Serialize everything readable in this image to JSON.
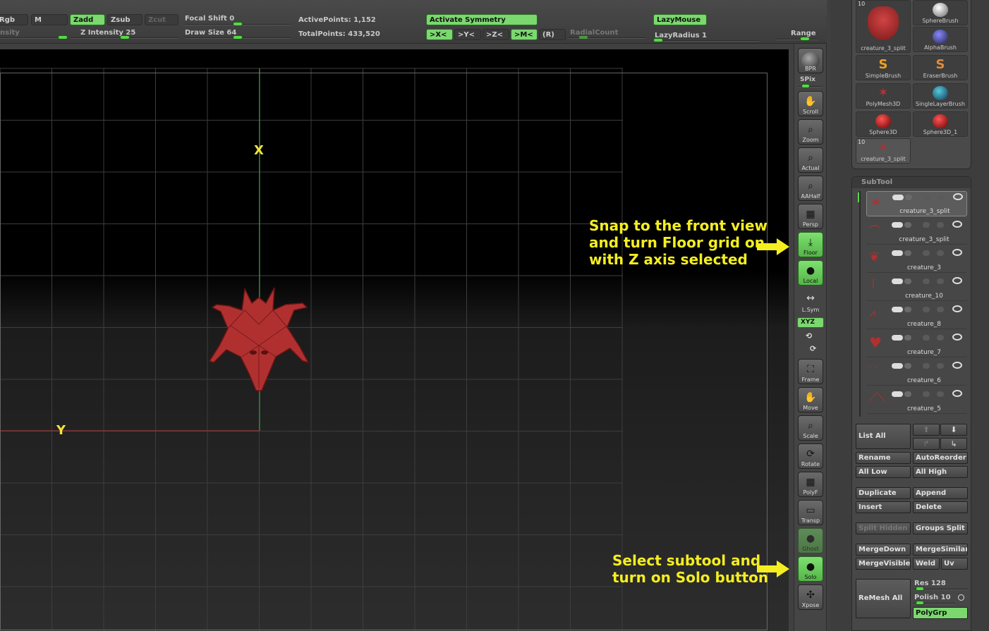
{
  "topbar": {
    "rgb": "Rgb",
    "m": "M",
    "zadd": "Zadd",
    "zsub": "Zsub",
    "zcut": "Zcut",
    "intensity_label": "nsity",
    "z_intensity": "Z Intensity 25",
    "focal_shift": "Focal Shift 0",
    "draw_size": "Draw Size 64",
    "active_points": "ActivePoints: 1,152",
    "total_points": "TotalPoints: 433,520",
    "activate_symmetry": "Activate Symmetry",
    "sym_x": ">X<",
    "sym_y": ">Y<",
    "sym_z": ">Z<",
    "sym_m": ">M<",
    "sym_r": "(R)",
    "radial_count": "RadialCount",
    "lazy_mouse": "LazyMouse",
    "lazy_radius": "LazyRadius 1",
    "range": "Range"
  },
  "viewport": {
    "x_axis_label": "X",
    "y_axis_label": "Y"
  },
  "shelf": [
    {
      "label": "BPR",
      "icon": "bpr-icon"
    },
    {
      "label": "SPix",
      "icon": "spix-slider"
    },
    {
      "label": "Scroll",
      "icon": "hand-icon"
    },
    {
      "label": "Zoom",
      "icon": "magnifier-icon"
    },
    {
      "label": "Actual",
      "icon": "magnifier-icon"
    },
    {
      "label": "AAHalf",
      "icon": "magnifier-icon"
    },
    {
      "label": "Persp",
      "icon": "perspective-icon"
    },
    {
      "label": "Floor",
      "icon": "floor-icon"
    },
    {
      "label": "Local",
      "icon": "local-icon"
    },
    {
      "label": "L.Sym",
      "icon": "lsym-icon"
    },
    {
      "label": "XYZ",
      "icon": "xyz-icon"
    },
    {
      "label": "Frame",
      "icon": "frame-icon"
    },
    {
      "label": "Move",
      "icon": "move-icon"
    },
    {
      "label": "Scale",
      "icon": "scale-icon"
    },
    {
      "label": "Rotate",
      "icon": "rotate-icon"
    },
    {
      "label": "PolyF",
      "icon": "polyf-icon"
    },
    {
      "label": "Transp",
      "icon": "transp-icon"
    },
    {
      "label": "Ghost",
      "icon": "ghost-icon"
    },
    {
      "label": "Solo",
      "icon": "solo-icon"
    },
    {
      "label": "Xpose",
      "icon": "xpose-icon"
    }
  ],
  "tools": [
    {
      "name": "creature_3_split",
      "num": "10"
    },
    {
      "name": "SphereBrush"
    },
    {
      "name": "AlphaBrush"
    },
    {
      "name": "SimpleBrush"
    },
    {
      "name": "EraserBrush"
    },
    {
      "name": "PolyMesh3D"
    },
    {
      "name": "SingleLayerBrush"
    },
    {
      "name": "Sphere3D"
    },
    {
      "name": "Sphere3D_1"
    },
    {
      "name": "creature_3_split",
      "num": "10"
    }
  ],
  "subtool": {
    "title": "SubTool",
    "items": [
      "creature_3_split",
      "creature_3_split",
      "creature_3",
      "creature_10",
      "creature_8",
      "creature_7",
      "creature_6",
      "creature_5"
    ],
    "list_all": "List All",
    "rename": "Rename",
    "autoreorder": "AutoReorder",
    "all_low": "All Low",
    "all_high": "All High",
    "duplicate": "Duplicate",
    "append": "Append",
    "insert": "Insert",
    "delete": "Delete",
    "split_hidden": "Split Hidden",
    "groups_split": "Groups Split",
    "mergedown": "MergeDown",
    "mergesimilar": "MergeSimilar",
    "mergevisible": "MergeVisible",
    "weld": "Weld",
    "uv": "Uv",
    "remesh_all": "ReMesh All",
    "res": "Res 128",
    "polish": "Polish 10",
    "polygrp": "PolyGrp"
  },
  "annotations": {
    "floor_line1": "Snap to the front view",
    "floor_line2": "and turn Floor grid on",
    "floor_line3": "with Z axis selected",
    "solo_line1": "Select subtool and",
    "solo_line2": "turn on Solo button"
  },
  "colors": {
    "accent_green": "#7bd86f",
    "annotation_yellow": "#f4ee20",
    "creature_red": "#b03030"
  }
}
